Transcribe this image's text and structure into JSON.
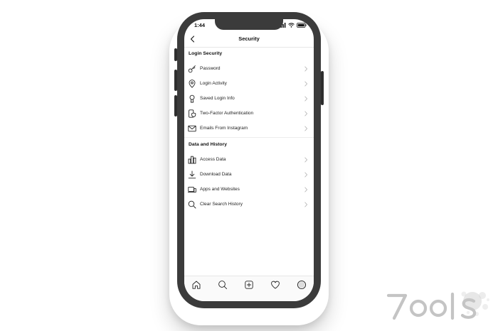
{
  "status_bar": {
    "time": "1:44"
  },
  "header": {
    "title": "Security",
    "back_icon": "chevron-left-icon"
  },
  "sections": [
    {
      "title": "Login Security",
      "items": [
        {
          "label": "Password",
          "icon": "key-icon"
        },
        {
          "label": "Login Activity",
          "icon": "location-pin-icon"
        },
        {
          "label": "Saved Login Info",
          "icon": "keyhole-icon"
        },
        {
          "label": "Two-Factor Authentication",
          "icon": "phone-shield-icon"
        },
        {
          "label": "Emails From Instagram",
          "icon": "envelope-icon"
        }
      ]
    },
    {
      "title": "Data and History",
      "items": [
        {
          "label": "Access Data",
          "icon": "bar-chart-icon"
        },
        {
          "label": "Download Data",
          "icon": "download-icon"
        },
        {
          "label": "Apps and Websites",
          "icon": "laptop-icon"
        },
        {
          "label": "Clear Search History",
          "icon": "search-icon"
        }
      ]
    }
  ],
  "tab_bar": [
    {
      "name": "home",
      "icon": "home-icon"
    },
    {
      "name": "search",
      "icon": "search-icon"
    },
    {
      "name": "new-post",
      "icon": "plus-square-icon"
    },
    {
      "name": "activity",
      "icon": "heart-icon"
    },
    {
      "name": "profile",
      "icon": "avatar-icon"
    }
  ],
  "watermark": {
    "text": "7ools",
    "color": "#c9c9c9"
  },
  "colors": {
    "frame": "#3b3b3b",
    "text": "#222222",
    "chevron": "#b3b3b3",
    "divider": "#ececec"
  }
}
